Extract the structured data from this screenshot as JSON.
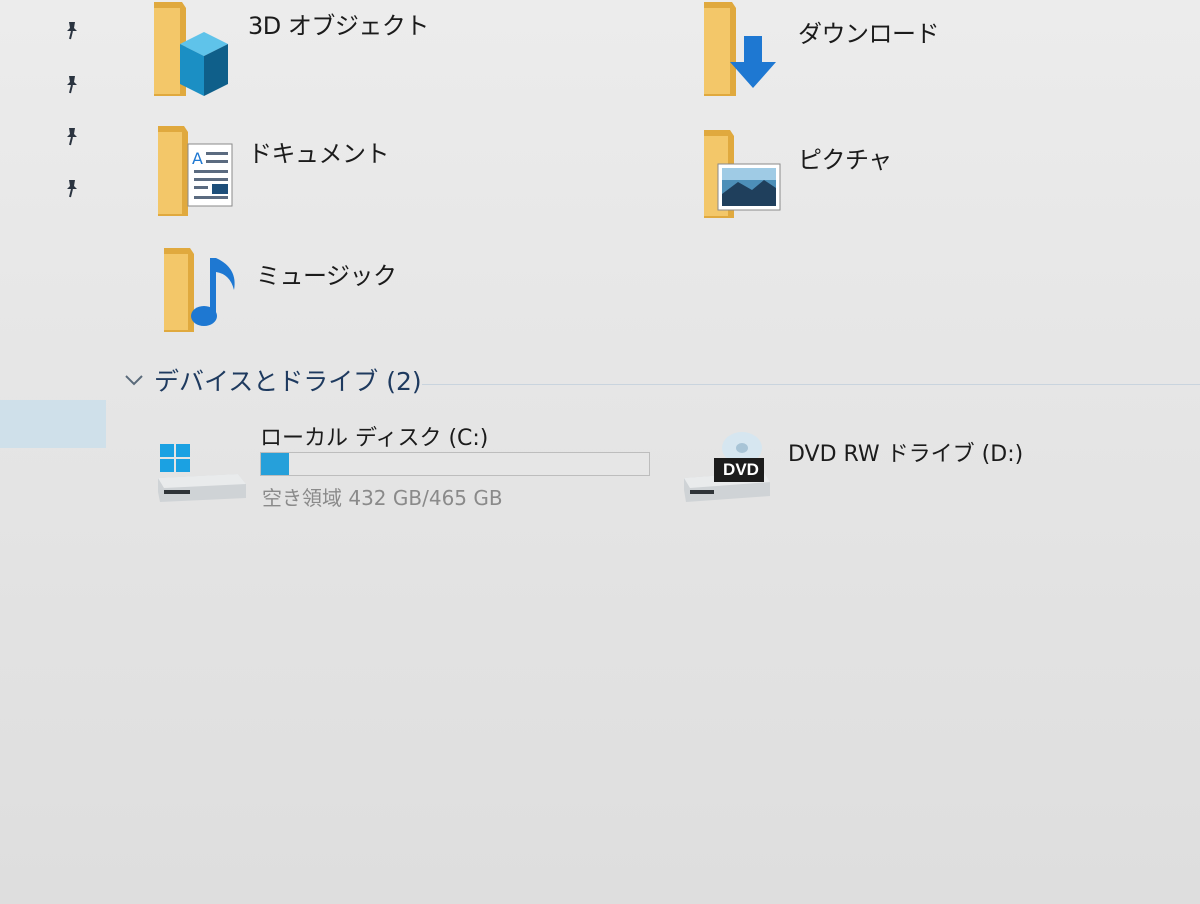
{
  "folders": [
    {
      "label": "3D オブジェクト",
      "icon": "3d-objects-folder-icon"
    },
    {
      "label": "ダウンロード",
      "icon": "downloads-folder-icon"
    },
    {
      "label": "ドキュメント",
      "icon": "documents-folder-icon"
    },
    {
      "label": "ピクチャ",
      "icon": "pictures-folder-icon"
    },
    {
      "label": "ミュージック",
      "icon": "music-folder-icon"
    }
  ],
  "devices_group": {
    "title": "デバイスとドライブ (2)"
  },
  "drives": [
    {
      "label": "ローカル ディスク (C:)",
      "free_space": "空き領域 432 GB/465 GB",
      "used_fraction": 0.071,
      "icon": "hard-drive-icon"
    },
    {
      "label": "DVD RW ドライブ (D:)",
      "badge": "DVD",
      "icon": "dvd-drive-icon"
    }
  ],
  "colors": {
    "folder": "#e8b64f",
    "accent": "#26a0da",
    "group_title": "#1e3a5f"
  }
}
